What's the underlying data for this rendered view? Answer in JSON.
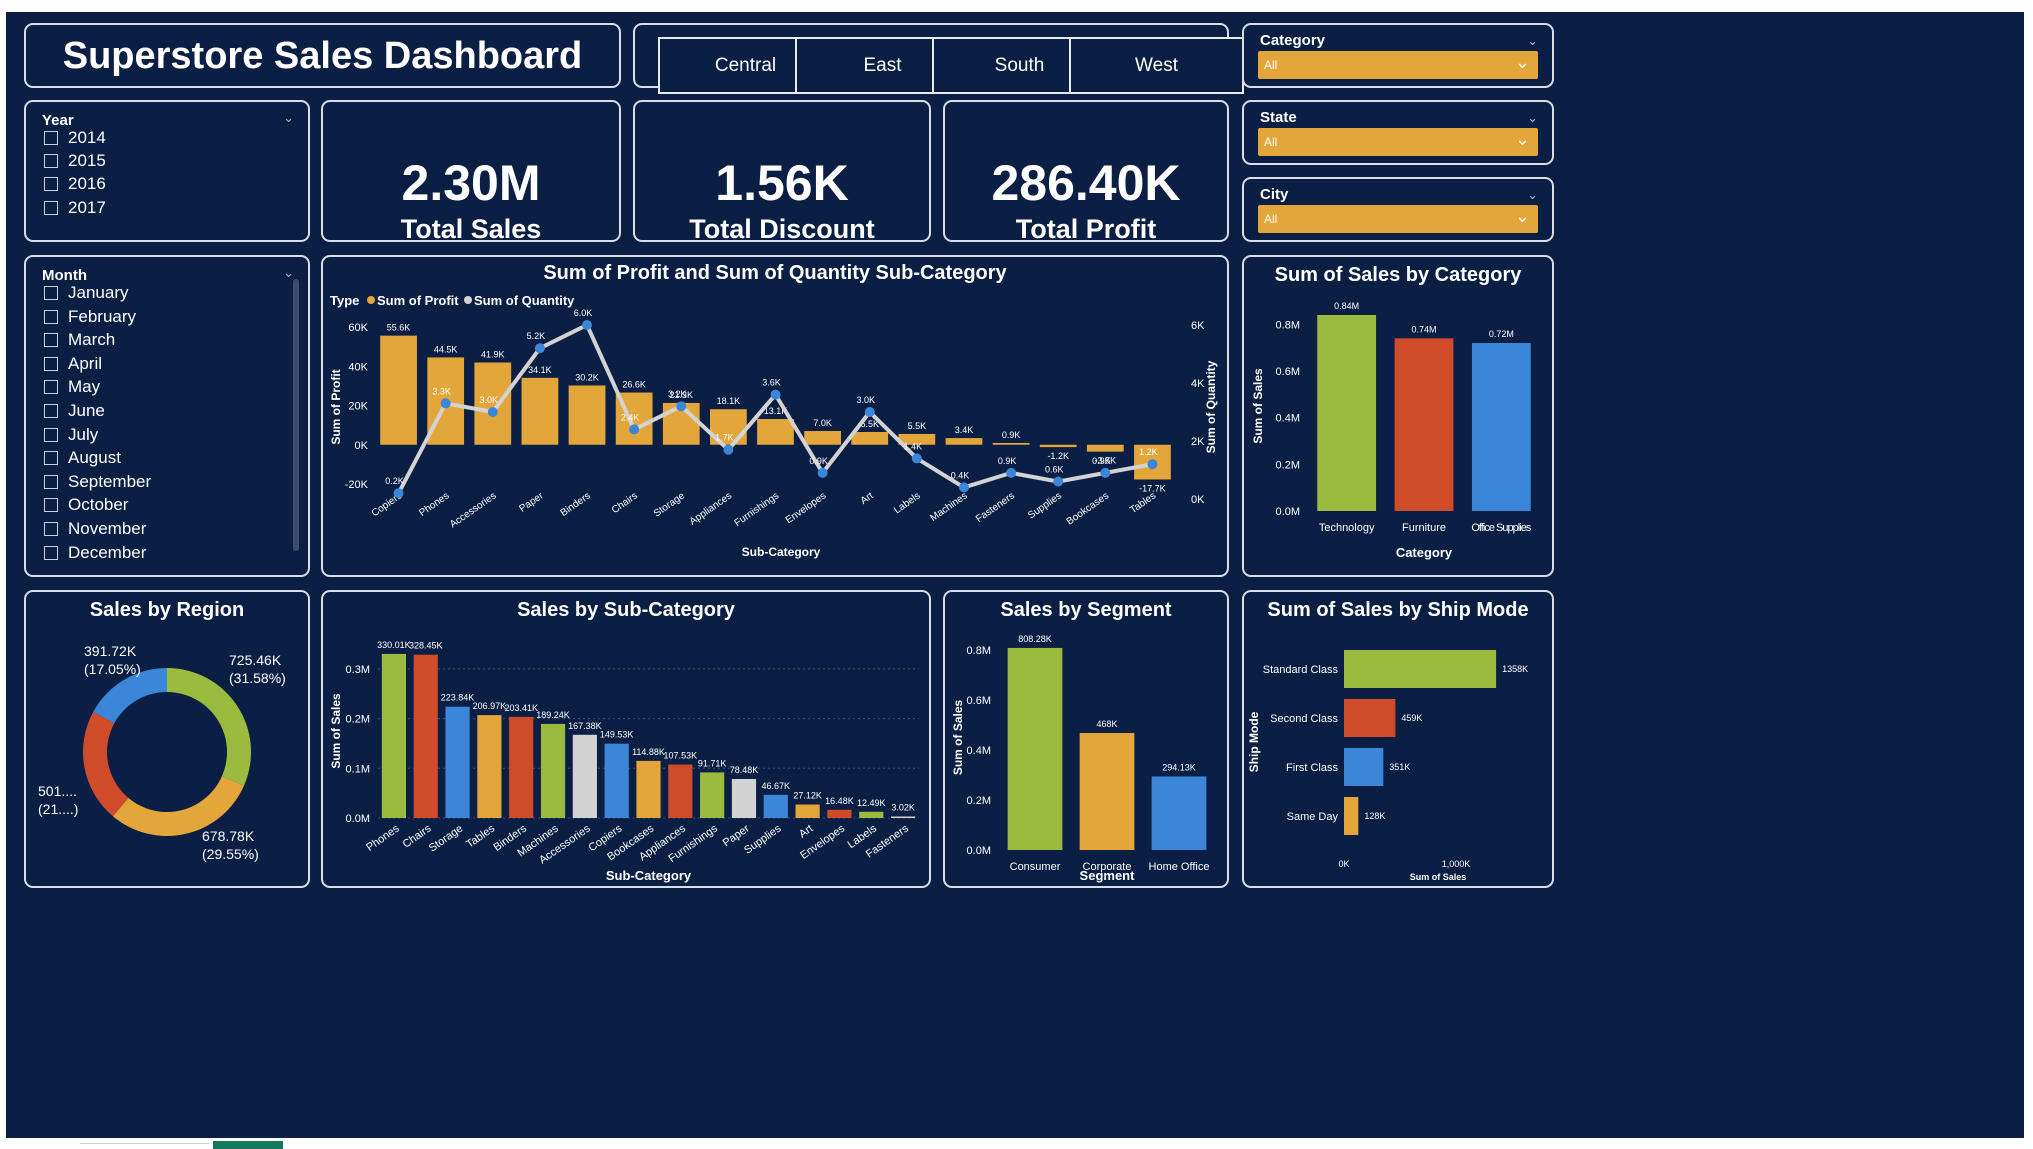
{
  "dashboard": {
    "title": "Superstore Sales Dashboard"
  },
  "regions": [
    "Central",
    "East",
    "South",
    "West"
  ],
  "kpis": [
    {
      "value": "2.30M",
      "label": "Total Sales"
    },
    {
      "value": "1.56K",
      "label": "Total Discount"
    },
    {
      "value": "286.40K",
      "label": "Total Profit"
    }
  ],
  "year_slicer": {
    "title": "Year",
    "items": [
      "2014",
      "2015",
      "2016",
      "2017"
    ]
  },
  "month_slicer": {
    "title": "Month",
    "items": [
      "January",
      "February",
      "March",
      "April",
      "May",
      "June",
      "July",
      "August",
      "September",
      "October",
      "November",
      "December"
    ]
  },
  "filters": [
    {
      "title": "Category",
      "value": "All"
    },
    {
      "title": "State",
      "value": "All"
    },
    {
      "title": "City",
      "value": "All"
    }
  ],
  "colors": {
    "background": "#0b1f44",
    "orange": "#e3a63b",
    "green": "#9bbb3e",
    "red": "#d04b2a",
    "blue": "#3b86d8",
    "gray": "#d3d3d3"
  },
  "chart_data": [
    {
      "id": "profit_quantity",
      "type": "bar",
      "title": "Sum of Profit and Sum of Quantity Sub-Category",
      "legend_title": "Type",
      "legend": [
        "Sum of Profit",
        "Sum of Quantity"
      ],
      "xlabel": "Sub-Category",
      "ylabel": "Sum of Profit",
      "y2label": "Sum of Quantity",
      "ylim": [
        -20000,
        60000
      ],
      "y2lim": [
        0,
        6000
      ],
      "yticks": [
        "60K",
        "40K",
        "20K",
        "0K",
        "-20K"
      ],
      "y2ticks": [
        "6K",
        "4K",
        "2K",
        "0K"
      ],
      "categories": [
        "Copiers",
        "Phones",
        "Accessories",
        "Paper",
        "Binders",
        "Chairs",
        "Storage",
        "Appliances",
        "Furnishings",
        "Envelopes",
        "Art",
        "Labels",
        "Machines",
        "Fasteners",
        "Supplies",
        "Bookcases",
        "Tables"
      ],
      "series": [
        {
          "name": "Sum of Profit",
          "values": [
            55600,
            44500,
            41900,
            34100,
            30200,
            26600,
            21300,
            18100,
            13100,
            7000,
            6500,
            5500,
            3400,
            900,
            -1200,
            -3500,
            -17700
          ],
          "labels": [
            "55.6K",
            "44.5K",
            "41.9K",
            "34.1K",
            "30.2K",
            "26.6K",
            "21.3K",
            "18.1K",
            "13.1K",
            "7.0K",
            "6.5K",
            "5.5K",
            "3.4K",
            "0.9K",
            "-1.2K",
            "-3.5K",
            "-17.7K"
          ]
        },
        {
          "name": "Sum of Quantity",
          "values": [
            200,
            3300,
            3000,
            5200,
            6000,
            2400,
            3200,
            1700,
            3600,
            900,
            3000,
            1400,
            400,
            900,
            600,
            900,
            1200
          ],
          "labels": [
            "0.2K",
            "3.3K",
            "3.0K",
            "5.2K",
            "6.0K",
            "2.4K",
            "3.2K",
            "1.7K",
            "3.6K",
            "0.9K",
            "3.0K",
            "1.4K",
            "0.4K",
            "0.9K",
            "0.6K",
            "0.9K",
            "1.2K"
          ]
        }
      ]
    },
    {
      "id": "sales_by_category",
      "type": "bar",
      "title": "Sum of Sales by Category",
      "xlabel": "Category",
      "ylabel": "Sum of Sales",
      "ylim": [
        0,
        0.9
      ],
      "yticks": [
        "0.8M",
        "0.6M",
        "0.4M",
        "0.2M",
        "0.0M"
      ],
      "categories": [
        "Technology",
        "Furniture",
        "Office Supplies"
      ],
      "values": [
        0.84,
        0.74,
        0.72
      ],
      "labels": [
        "0.84M",
        "0.74M",
        "0.72M"
      ],
      "bar_colors": [
        "#9bbb3e",
        "#d04b2a",
        "#3b86d8"
      ]
    },
    {
      "id": "sales_by_region",
      "type": "pie",
      "title": "Sales by Region",
      "values": [
        725460,
        678780,
        501000,
        391720
      ],
      "labels": [
        "725.46K",
        "678.78K",
        "501....",
        "391.72K"
      ],
      "percents": [
        "(31.58%)",
        "(29.55%)",
        "(21....)",
        "(17.05%)"
      ],
      "slice_colors": [
        "#9bbb3e",
        "#e3a63b",
        "#d04b2a",
        "#3b86d8"
      ]
    },
    {
      "id": "sales_by_subcategory",
      "type": "bar",
      "title": "Sales by Sub-Category",
      "xlabel": "Sub-Category",
      "ylabel": "Sum of Sales",
      "ylim": [
        0,
        0.35
      ],
      "yticks": [
        "0.3M",
        "0.2M",
        "0.1M",
        "0.0M"
      ],
      "categories": [
        "Phones",
        "Chairs",
        "Storage",
        "Tables",
        "Binders",
        "Machines",
        "Accessories",
        "Copiers",
        "Bookcases",
        "Appliances",
        "Furnishings",
        "Paper",
        "Supplies",
        "Art",
        "Envelopes",
        "Labels",
        "Fasteners"
      ],
      "values": [
        0.33001,
        0.32845,
        0.22384,
        0.20697,
        0.20341,
        0.18924,
        0.16738,
        0.14953,
        0.11488,
        0.10753,
        0.09171,
        0.07848,
        0.04667,
        0.02712,
        0.01648,
        0.01249,
        0.00302
      ],
      "labels": [
        "330.01K",
        "328.45K",
        "223.84K",
        "206.97K",
        "203.41K",
        "189.24K",
        "167.38K",
        "149.53K",
        "114.88K",
        "107.53K",
        "91.71K",
        "78.48K",
        "46.67K",
        "27.12K",
        "16.48K",
        "12.49K",
        "3.02K"
      ],
      "bar_colors": [
        "#9bbb3e",
        "#d04b2a",
        "#3b86d8",
        "#e3a63b",
        "#d04b2a",
        "#9bbb3e",
        "#d3d3d3",
        "#3b86d8",
        "#e3a63b",
        "#d04b2a",
        "#9bbb3e",
        "#d3d3d3",
        "#3b86d8",
        "#e3a63b",
        "#d04b2a",
        "#9bbb3e",
        "#d3d3d3"
      ]
    },
    {
      "id": "sales_by_segment",
      "type": "bar",
      "title": "Sales by Segment",
      "xlabel": "Segment",
      "ylabel": "Sum of Sales",
      "ylim": [
        0,
        0.9
      ],
      "yticks": [
        "0.8M",
        "0.6M",
        "0.4M",
        "0.2M",
        "0.0M"
      ],
      "categories": [
        "Consumer",
        "Corporate",
        "Home Office"
      ],
      "values": [
        0.80828,
        0.468,
        0.29413
      ],
      "labels": [
        "808.28K",
        "468K",
        "294.13K"
      ],
      "bar_colors": [
        "#9bbb3e",
        "#e3a63b",
        "#3b86d8"
      ]
    },
    {
      "id": "sales_by_shipmode",
      "type": "bar",
      "orientation": "horizontal",
      "title": "Sum of Sales by Ship Mode",
      "xlabel": "Sum of Sales",
      "ylabel": "Ship Mode",
      "xlim": [
        0,
        1500
      ],
      "xticks": [
        "0K",
        "1,000K"
      ],
      "categories": [
        "Standard Class",
        "Second Class",
        "First Class",
        "Same Day"
      ],
      "values": [
        1358,
        459,
        351,
        128
      ],
      "labels": [
        "1358K",
        "459K",
        "351K",
        "128K"
      ],
      "bar_colors": [
        "#9bbb3e",
        "#d04b2a",
        "#3b86d8",
        "#e3a63b"
      ]
    }
  ]
}
